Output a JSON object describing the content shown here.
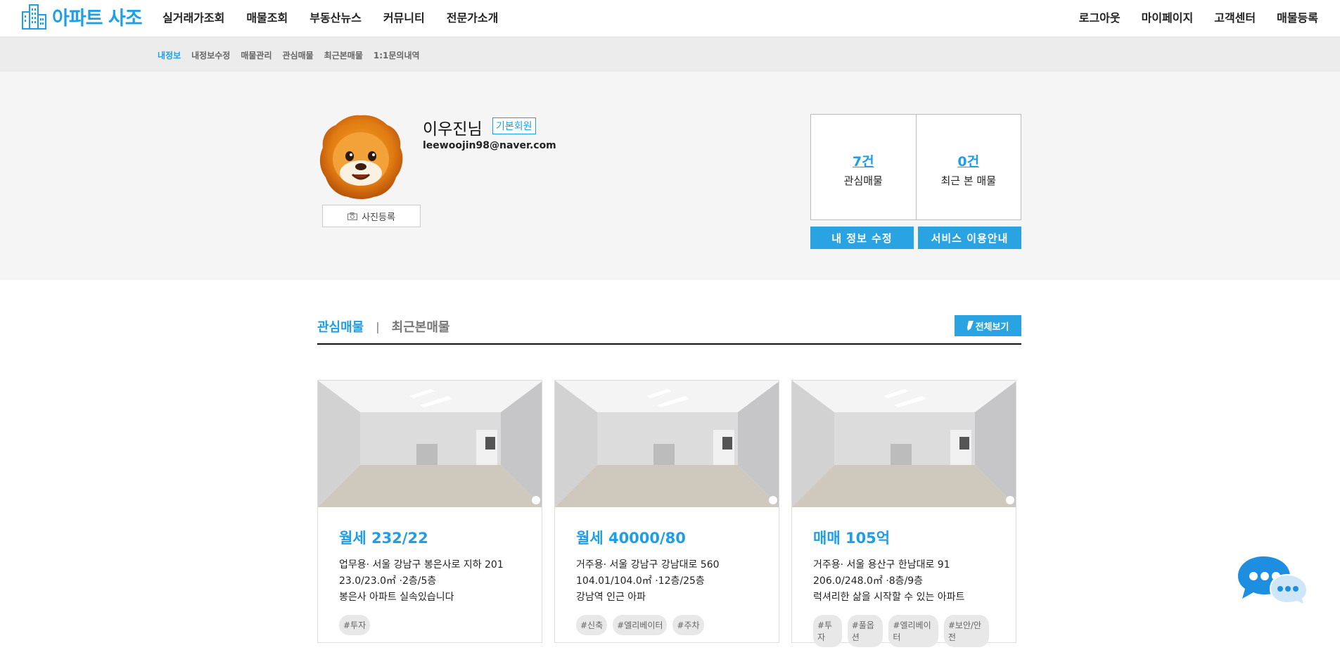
{
  "header": {
    "logo_text": "아파트 사조",
    "nav": [
      "실거래가조회",
      "매물조회",
      "부동산뉴스",
      "커뮤니티",
      "전문가소개"
    ],
    "util": [
      "로그아웃",
      "마이페이지",
      "고객센터",
      "매물등록"
    ]
  },
  "subnav": {
    "items": [
      "내정보",
      "내정보수정",
      "매물관리",
      "관심매물",
      "최근본매물",
      "1:1문의내역"
    ],
    "active": "내정보"
  },
  "profile": {
    "name": "이우진님",
    "badge": "기본회원",
    "email": "leewoojin98@naver.com",
    "photo_button": "사진등록",
    "avatar_icon": "lion-memoji-avatar"
  },
  "stats": {
    "favorites_count": "7건",
    "favorites_label": "관심매물",
    "recent_count": "0건",
    "recent_label": "최근 본 매물"
  },
  "actions": {
    "edit_info": "내 정보 수정",
    "service_guide": "서비스 이용안내"
  },
  "listing_section": {
    "tab_active": "관심매물",
    "separator": "|",
    "tab_inactive": "최근본매물",
    "view_all": "전체보기"
  },
  "cards": [
    {
      "price": "월세 232/22",
      "address": "업무용· 서울 강남구 봉은사로 지하 201",
      "area_floor": "23.0/23.0㎡ ·2층/5층",
      "description": "봉은사 아파트 실속있습니다",
      "tags": [
        "#투자"
      ]
    },
    {
      "price": "월세 40000/80",
      "address": "거주용· 서울 강남구 강남대로 560",
      "area_floor": "104.01/104.0㎡ ·12층/25층",
      "description": "강남역 인근 아파",
      "tags": [
        "#신축",
        "#엘리베이터",
        "#주차"
      ]
    },
    {
      "price": "매매 105억",
      "address": "거주용· 서울 용산구 한남대로 91",
      "area_floor": "206.0/248.0㎡ ·8층/9층",
      "description": "럭셔리한 삶을 시작할 수 있는 아파트",
      "tags": [
        "#투자",
        "#풀옵션",
        "#엘리베이터",
        "#보안/안전"
      ]
    }
  ],
  "colors": {
    "accent": "#1e9ee8",
    "button": "#2aa3e2",
    "subnav_bg": "#ececec",
    "profile_bg": "#f5f5f5"
  }
}
